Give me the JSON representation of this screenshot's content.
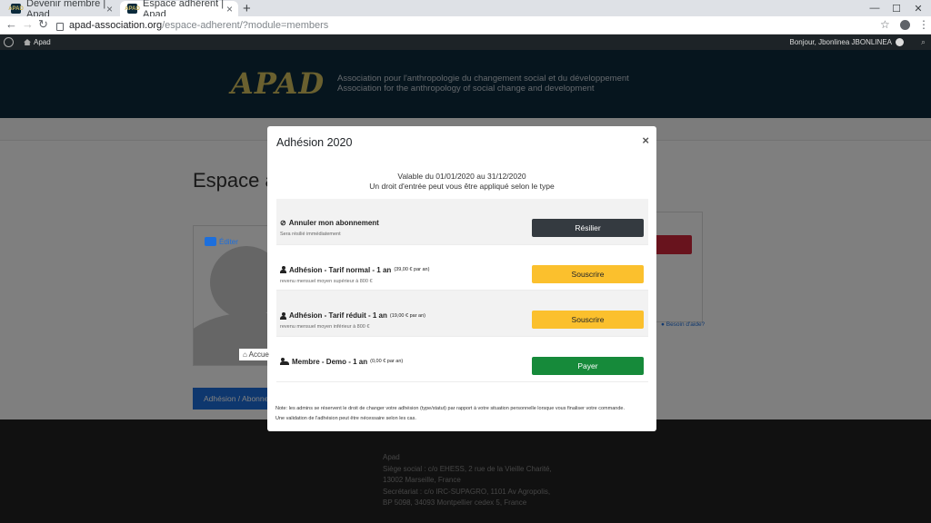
{
  "browser": {
    "tabs": [
      {
        "title": "Devenir membre | Apad",
        "active": false
      },
      {
        "title": "Espace adhérent | Apad",
        "active": true
      }
    ],
    "url_host": "apad-association.org",
    "url_path": "/espace-adherent/?module=members",
    "favicon_text": "APAD"
  },
  "adminbar": {
    "site_name": "Apad",
    "greeting": "Bonjour, Jbonlinea JBONLINEA"
  },
  "header": {
    "logo": "APAD",
    "tagline_fr": "Association pour l'anthropologie du changement social et du développement",
    "tagline_en": "Association for the anthropology of social change and development"
  },
  "page": {
    "title": "Espace a",
    "edit_label": "Éditer",
    "home_label": "Accue",
    "side_button": "Adhésion / Abonneme",
    "help_label": "Besoin d'aide?"
  },
  "footer": {
    "lines": [
      "Apad",
      "Siège social : c/o EHESS, 2 rue de la Vieille Charité,",
      "13002 Marseille, France",
      "Secrétariat : c/o IRC-SUPAGRO, 1101 Av Agropolis,",
      "BP 5098, 34093 Montpellier cedex 5, France"
    ]
  },
  "modal": {
    "title": "Adhésion 2020",
    "close": "×",
    "validity": "Valable du 01/01/2020 au 31/12/2020",
    "entry_fee_notice": "Un droit d'entrée peut vous être appliqué selon le type",
    "plans": [
      {
        "name": "Annuler mon abonnement",
        "price": "",
        "desc": "Sera résilié immédiatement",
        "button": "Résilier",
        "style": "dark"
      },
      {
        "name": "Adhésion - Tarif normal - 1 an",
        "price": "(39,00 € par an)",
        "desc": "revenu mensuel moyen supérieur à 800 €",
        "button": "Souscrire",
        "style": "warning"
      },
      {
        "name": "Adhésion - Tarif réduit - 1 an",
        "price": "(19,00 € par an)",
        "desc": "revenu mensuel moyen inférieur à 800 €",
        "button": "Souscrire",
        "style": "warning"
      },
      {
        "name": "Membre - Demo - 1 an",
        "price": "(0,00 € par an)",
        "desc": "",
        "button": "Payer",
        "style": "success"
      }
    ],
    "note_line1": "Note: les admins se réservent le droit de changer votre adhésion (type/statut) par rapport à votre situation personnelle lorsque vous finaliser votre commande.",
    "note_line2": "Une validation de l'adhésion peut être nécessaire selon les cas."
  },
  "colors": {
    "header_bg": "#0c2a3d",
    "logo": "#d4c15f",
    "btn_dark": "#343a40",
    "btn_warning": "#fbc02d",
    "btn_success": "#168a3a",
    "primary": "#1d6fdc"
  }
}
